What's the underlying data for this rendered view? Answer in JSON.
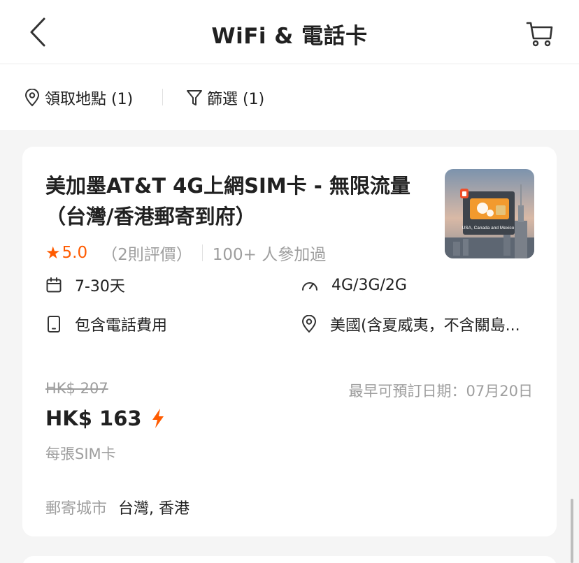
{
  "header": {
    "title": "WiFi & 電話卡",
    "back_icon": "chevron-left-icon",
    "cart_icon": "cart-icon"
  },
  "filters": {
    "location_label": "領取地點 (1)",
    "filter_label": "篩選 (1)"
  },
  "product": {
    "title": "美加墨AT&T 4G上網SIM卡 - 無限流量（台灣/香港郵寄到府）",
    "image_caption": "USA, Canada and Mexico",
    "rating": {
      "score": "5.0",
      "reviews": "（2則評價）",
      "booked": "100+ 人參加過"
    },
    "attributes": {
      "duration": "7-30天",
      "network": "4G/3G/2G",
      "calls": "包含電話費用",
      "coverage": "美國(含夏威夷，不含關島..."
    },
    "original_price": "HK$ 207",
    "price": "HK$ 163",
    "unit": "每張SIM卡",
    "earliest_date": "最早可預訂日期：07月20日",
    "mail_city_label": "郵寄城市",
    "mail_city_value": "台灣, 香港"
  },
  "colors": {
    "accent": "#ff5b00",
    "muted": "#9e9e9e",
    "text": "#212121",
    "background": "#f5f5f5"
  }
}
